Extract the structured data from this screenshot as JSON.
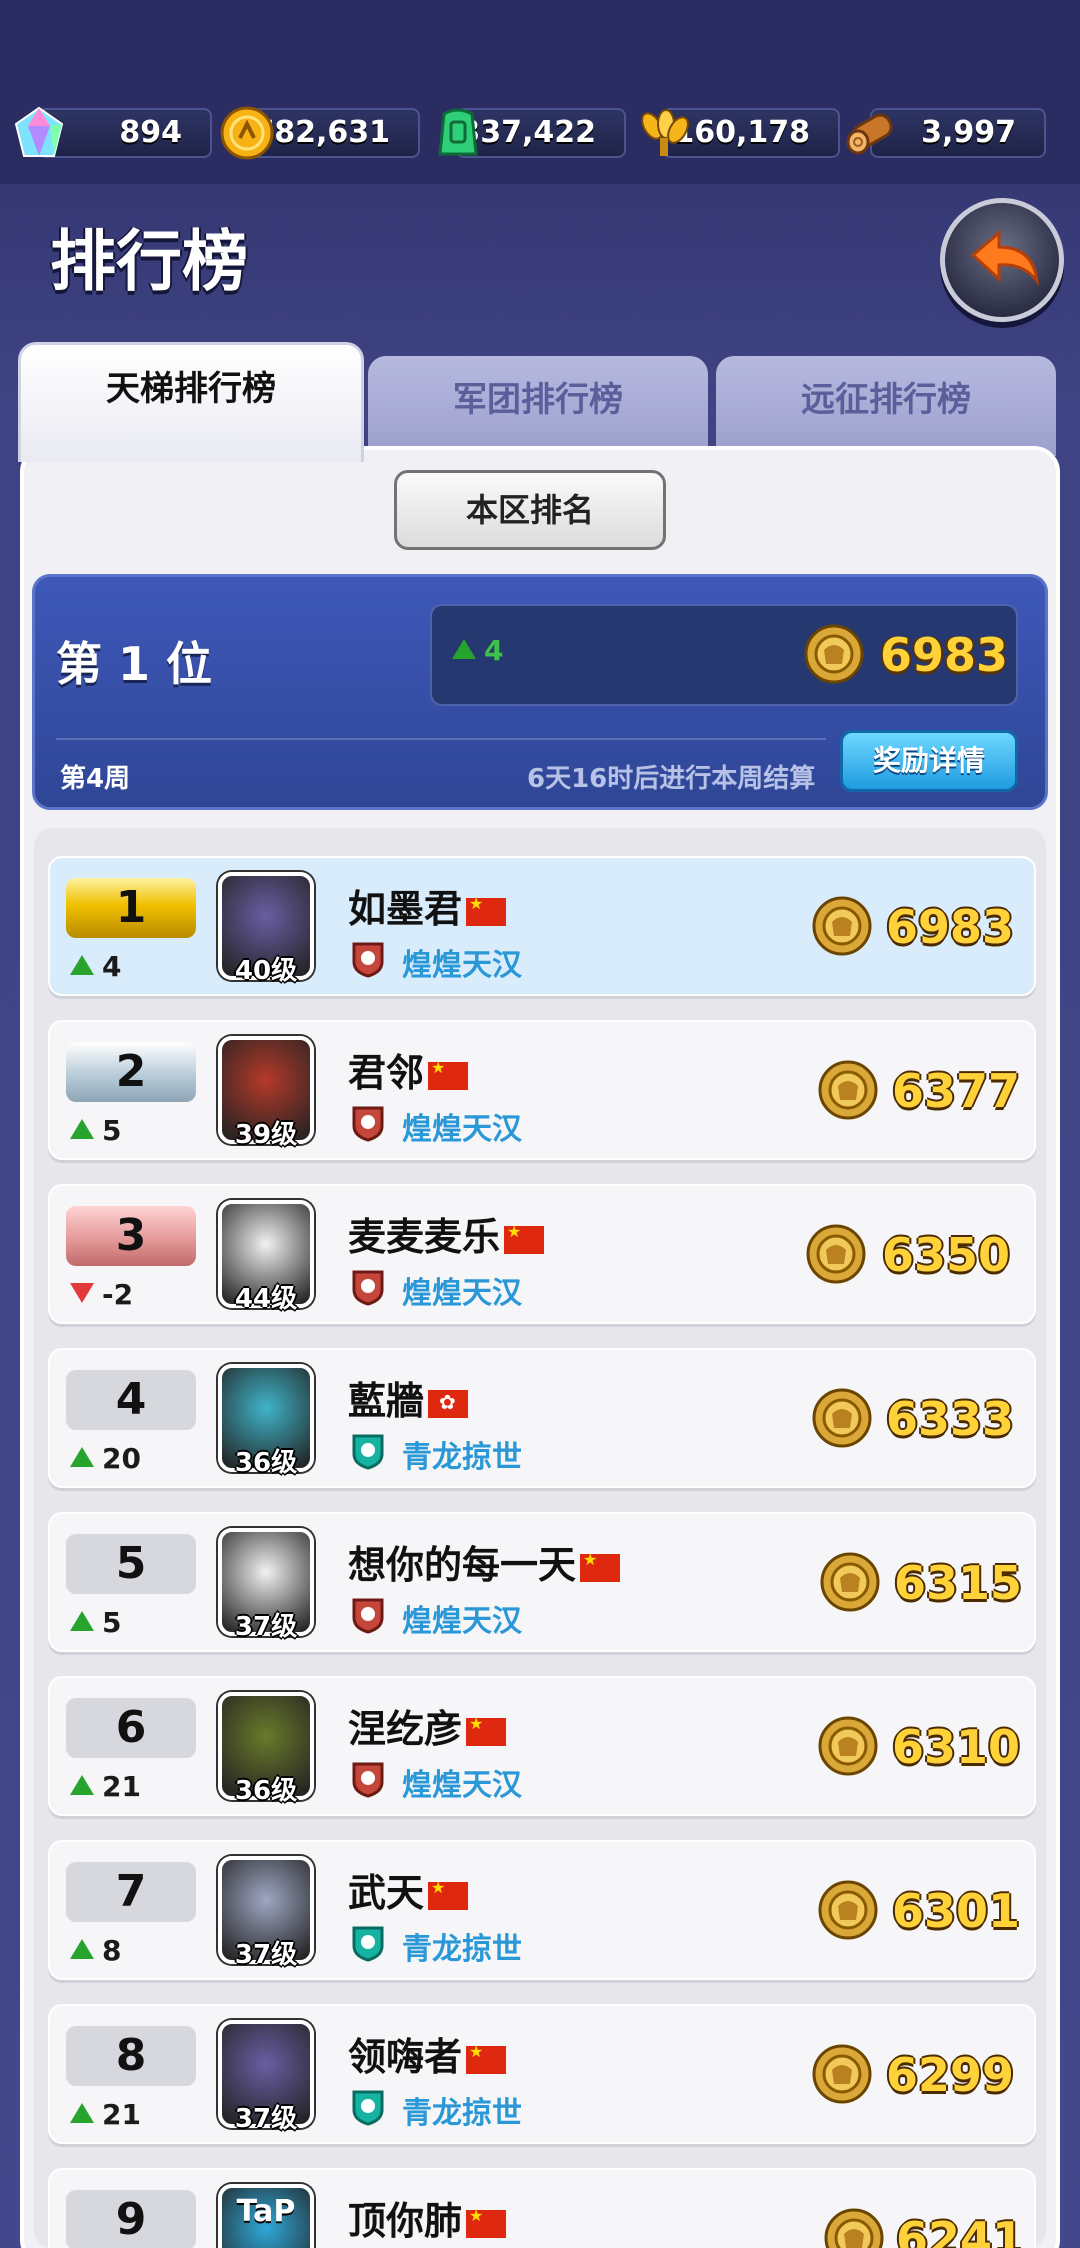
{
  "resources": [
    {
      "name": "gem",
      "icon": "gem-icon",
      "value": "894"
    },
    {
      "name": "gold",
      "icon": "gold-coin-icon",
      "value": "782,631"
    },
    {
      "name": "jade",
      "icon": "jade-tablet-icon",
      "value": "337,422"
    },
    {
      "name": "grain",
      "icon": "wheat-icon",
      "value": "160,178"
    },
    {
      "name": "wood",
      "icon": "wood-log-icon",
      "value": "3,997"
    }
  ],
  "header": {
    "title": "排行榜",
    "back_icon": "back-arrow-icon"
  },
  "tabs": [
    {
      "label": "天梯排行榜",
      "active": true
    },
    {
      "label": "军团排行榜",
      "active": false
    },
    {
      "label": "远征排行榜",
      "active": false
    }
  ],
  "region_button": "本区排名",
  "my_rank": {
    "position": "第 1 位",
    "change": "4",
    "score": "6983",
    "week": "第4周",
    "settle_text": "6天16时后进行本周结算",
    "reward_button": "奖励详情"
  },
  "rows": [
    {
      "rank": "1",
      "change": "4",
      "dir": "up",
      "name": "如墨君",
      "flag": "cn",
      "level": "40级",
      "legion": "煌煌天汉",
      "legion_icon": "red-legion-icon",
      "score": "6983"
    },
    {
      "rank": "2",
      "change": "5",
      "dir": "up",
      "name": "君邻",
      "flag": "cn",
      "level": "39级",
      "legion": "煌煌天汉",
      "legion_icon": "red-legion-icon",
      "score": "6377"
    },
    {
      "rank": "3",
      "change": "-2",
      "dir": "down",
      "name": "麦麦麦乐",
      "flag": "cn",
      "level": "44级",
      "legion": "煌煌天汉",
      "legion_icon": "red-legion-icon",
      "score": "6350"
    },
    {
      "rank": "4",
      "change": "20",
      "dir": "up",
      "name": "藍牆",
      "flag": "hk",
      "level": "36级",
      "legion": "青龙掠世",
      "legion_icon": "teal-legion-icon",
      "score": "6333"
    },
    {
      "rank": "5",
      "change": "5",
      "dir": "up",
      "name": "想你的每一天",
      "flag": "cn",
      "level": "37级",
      "legion": "煌煌天汉",
      "legion_icon": "red-legion-icon",
      "score": "6315"
    },
    {
      "rank": "6",
      "change": "21",
      "dir": "up",
      "name": "涅纥彦",
      "flag": "cn",
      "level": "36级",
      "legion": "煌煌天汉",
      "legion_icon": "red-legion-icon",
      "score": "6310"
    },
    {
      "rank": "7",
      "change": "8",
      "dir": "up",
      "name": "武天",
      "flag": "cn",
      "level": "37级",
      "legion": "青龙掠世",
      "legion_icon": "teal-legion-icon",
      "score": "6301"
    },
    {
      "rank": "8",
      "change": "21",
      "dir": "up",
      "name": "领嗨者",
      "flag": "cn",
      "level": "37级",
      "legion": "青龙掠世",
      "legion_icon": "teal-legion-icon",
      "score": "6299"
    },
    {
      "rank": "9",
      "name": "顶你肺",
      "flag": "cn",
      "score": "6241",
      "avatar_text": "TaP"
    }
  ],
  "colors": {
    "gold_score": "#ffd23a",
    "legion_text": "#2a97d6",
    "up": "#28a42e",
    "down": "#e23a3a",
    "panel_blue": "#3e58b9"
  }
}
